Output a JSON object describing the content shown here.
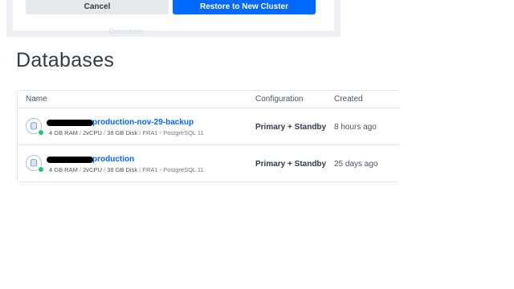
{
  "modal": {
    "cancel_label": "Cancel",
    "restore_label": "Restore to New Cluster",
    "ghost_left": "Databases",
    "ghost_right": "Configuration"
  },
  "page": {
    "title": "Databases"
  },
  "table": {
    "headers": {
      "name": "Name",
      "configuration": "Configuration",
      "created": "Created"
    },
    "rows": [
      {
        "name": "production-nov-29-backup",
        "ram": "4 GB RAM",
        "cpu": "2vCPU",
        "disk": "38 GB Disk",
        "region": "FRA1 - PostgreSQL 11",
        "separator": "/",
        "configuration": "Primary + Standby",
        "created": "8 hours ago",
        "status_color": "#15cd72"
      },
      {
        "name": "production",
        "ram": "4 GB RAM",
        "cpu": "2vCPU",
        "disk": "38 GB Disk",
        "region": "FRA1 - PostgreSQL 11",
        "separator": "/",
        "configuration": "Primary + Standby",
        "created": "25 days ago",
        "status_color": "#15cd72"
      }
    ]
  },
  "colors": {
    "link": "#0069ff",
    "primary_button": "#0069ff",
    "status_online": "#15cd72"
  }
}
